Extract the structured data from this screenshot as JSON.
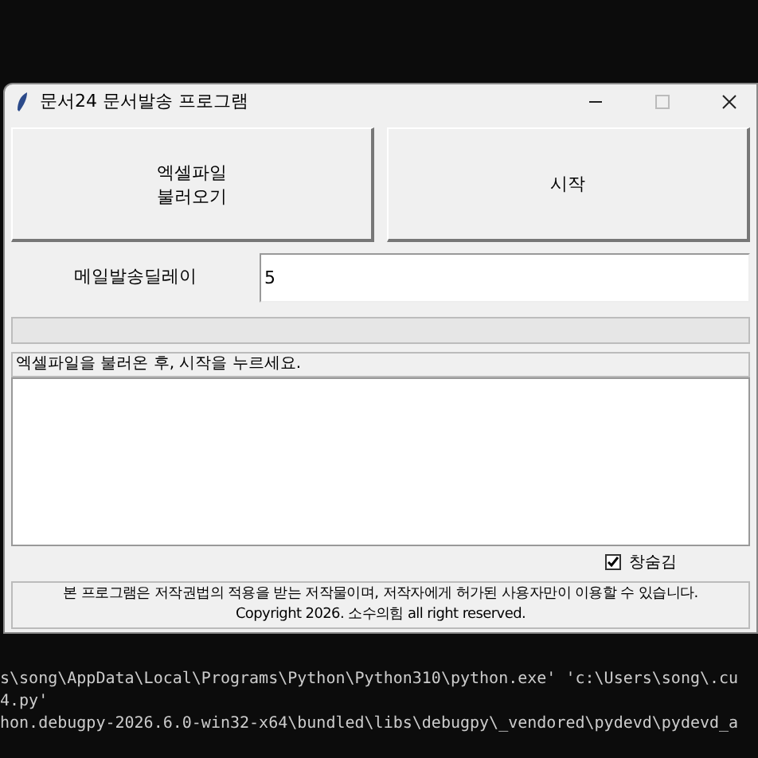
{
  "window": {
    "title": "문서24 문서발송 프로그램"
  },
  "buttons": [
    {
      "label": "엑셀파일\n불러오기"
    },
    {
      "label": "시작"
    }
  ],
  "delay": {
    "label": "메일발송딜레이",
    "value": "5"
  },
  "progress": {
    "level": 0
  },
  "status": "엑셀파일을 불러온 후, 시작을 누르세요.",
  "hide_window": {
    "label": "창숨김",
    "checked": true
  },
  "footer": [
    "본 프로그램은 저작권법의 적용을 받는 저작물이며, 저작자에게 허가된 사용자만이 이용할 수 있습니다.",
    "Copyright 2026. 소수의힘 all right reserved."
  ],
  "terminal": {
    "lines": [
      "s\\song\\AppData\\Local\\Programs\\Python\\Python310\\python.exe' 'c:\\Users\\song\\.cu",
      "4.py'",
      "hon.debugpy-2026.6.0-win32-x64\\bundled\\libs\\debugpy\\_vendored\\pydevd\\pydevd_a"
    ]
  }
}
